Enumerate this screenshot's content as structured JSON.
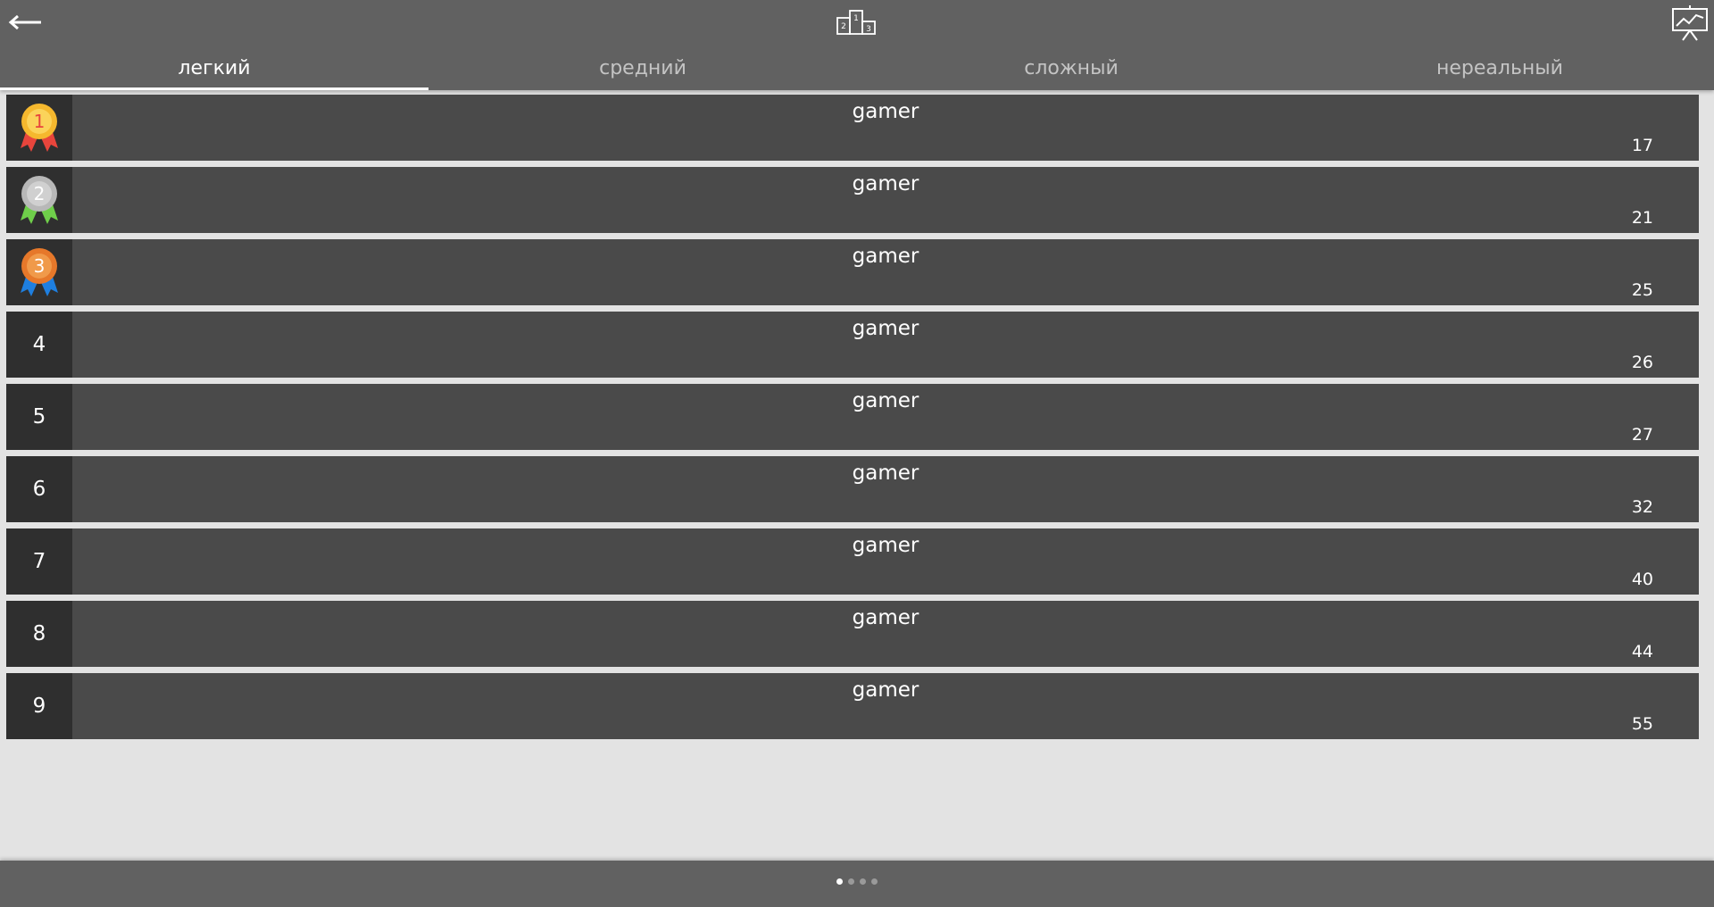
{
  "header": {
    "back_icon": "arrow-left-icon",
    "podium_icon": "podium-icon",
    "podium_numbers": [
      "2",
      "1",
      "3"
    ],
    "chart_icon": "chart-board-icon"
  },
  "tabs": [
    {
      "label": "легкий",
      "active": true
    },
    {
      "label": "средний",
      "active": false
    },
    {
      "label": "сложный",
      "active": false
    },
    {
      "label": "нереальный",
      "active": false
    }
  ],
  "leaderboard": [
    {
      "rank": "1",
      "name": "gamer",
      "score": "17",
      "medal": "gold"
    },
    {
      "rank": "2",
      "name": "gamer",
      "score": "21",
      "medal": "silver"
    },
    {
      "rank": "3",
      "name": "gamer",
      "score": "25",
      "medal": "bronze"
    },
    {
      "rank": "4",
      "name": "gamer",
      "score": "26"
    },
    {
      "rank": "5",
      "name": "gamer",
      "score": "27"
    },
    {
      "rank": "6",
      "name": "gamer",
      "score": "32"
    },
    {
      "rank": "7",
      "name": "gamer",
      "score": "40"
    },
    {
      "rank": "8",
      "name": "gamer",
      "score": "44"
    },
    {
      "rank": "9",
      "name": "gamer",
      "score": "55"
    }
  ],
  "medals": {
    "gold": {
      "disc": "#f5b82e",
      "inner": "#fbd35a",
      "ribbon": "#e8453c",
      "text": "#e8453c"
    },
    "silver": {
      "disc": "#b8b8b8",
      "inner": "#d0d0d0",
      "ribbon": "#6fcf4a",
      "text": "#ffffff"
    },
    "bronze": {
      "disc": "#e6782a",
      "inner": "#f09a4a",
      "ribbon": "#1e7fe0",
      "text": "#ffffff"
    }
  },
  "pagination": {
    "pages": 4,
    "current": 1
  },
  "colors": {
    "header": "#616161",
    "background": "#e3e3e3",
    "row": "#4a4a4a",
    "rank_cell": "#2f2f2f"
  }
}
